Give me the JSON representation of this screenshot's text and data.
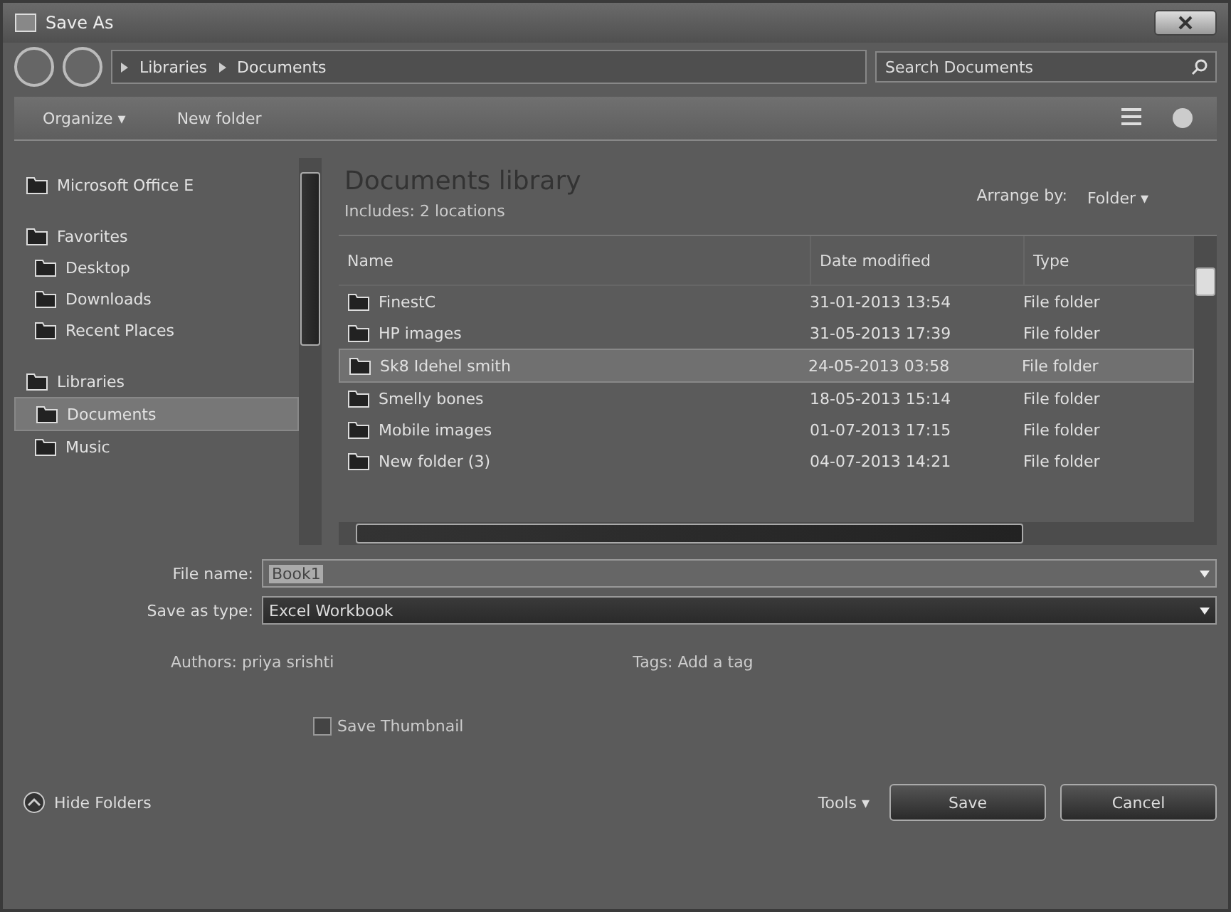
{
  "window": {
    "title": "Save As"
  },
  "address": {
    "crumbs": [
      "Libraries",
      "Documents"
    ],
    "search_placeholder": "Search Documents"
  },
  "toolbar": {
    "organize": "Organize ▾",
    "new_folder": "New folder"
  },
  "sidebar": {
    "items": [
      {
        "kind": "group",
        "label": "Microsoft Office E",
        "selected": false
      },
      {
        "kind": "group",
        "label": "Favorites",
        "selected": false
      },
      {
        "kind": "item",
        "label": "Desktop",
        "selected": false
      },
      {
        "kind": "item",
        "label": "Downloads",
        "selected": false
      },
      {
        "kind": "item",
        "label": "Recent Places",
        "selected": false
      },
      {
        "kind": "group",
        "label": "Libraries",
        "selected": false
      },
      {
        "kind": "item",
        "label": "Documents",
        "selected": true
      },
      {
        "kind": "item",
        "label": "Music",
        "selected": false
      }
    ]
  },
  "library": {
    "title": "Documents library",
    "subtitle": "Includes: 2 locations",
    "arrange_label": "Arrange by:",
    "arrange_value": "Folder ▾"
  },
  "table": {
    "columns": [
      "Name",
      "Date modified",
      "Type"
    ],
    "rows": [
      {
        "name": "FinestC",
        "date": "31-01-2013 13:54",
        "type": "File folder",
        "selected": false
      },
      {
        "name": "HP images",
        "date": "31-05-2013 17:39",
        "type": "File folder",
        "selected": false
      },
      {
        "name": "Sk8 Idehel smith",
        "date": "24-05-2013 03:58",
        "type": "File folder",
        "selected": true
      },
      {
        "name": "Smelly bones",
        "date": "18-05-2013 15:14",
        "type": "File folder",
        "selected": false
      },
      {
        "name": "Mobile images",
        "date": "01-07-2013 17:15",
        "type": "File folder",
        "selected": false
      },
      {
        "name": "New folder (3)",
        "date": "04-07-2013 14:21",
        "type": "File folder",
        "selected": false
      }
    ]
  },
  "form": {
    "file_name_label": "File name:",
    "file_name": "Book1",
    "type_label": "Save as type:",
    "type_value": "Excel Workbook",
    "authors": "Authors: priya srishti",
    "tags": "Tags: Add a tag",
    "thumbnail": {
      "label": "Save Thumbnail",
      "checked": false
    }
  },
  "footer": {
    "hide_folders": "Hide Folders",
    "tools": "Tools ▾",
    "save": "Save",
    "cancel": "Cancel"
  }
}
